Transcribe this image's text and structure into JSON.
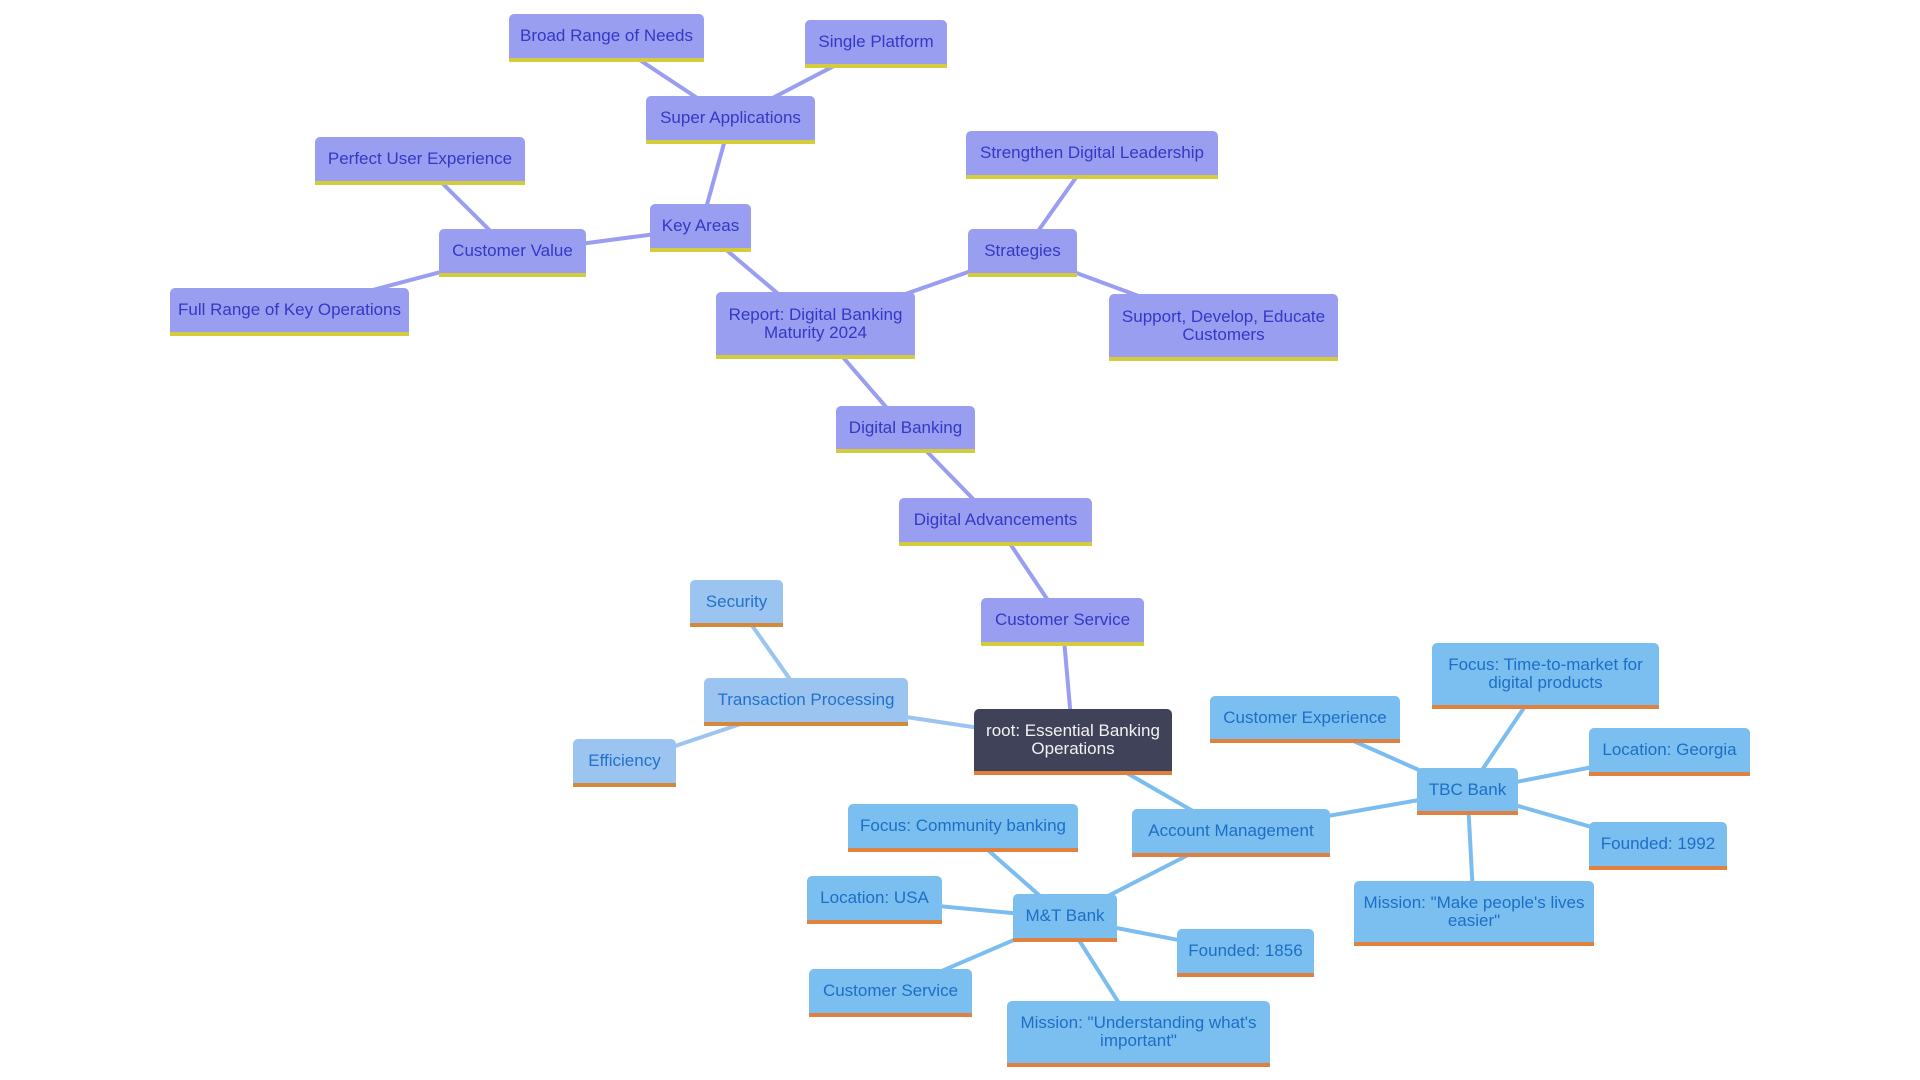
{
  "diagram": {
    "type": "mindmap",
    "colors": {
      "root_fill": "#404259",
      "root_text": "#f2f2f2",
      "purple_fill": "#999ef1",
      "purple_text": "#3438c5",
      "purple_accent": "#d4cb3d",
      "blue_fill": "#7bbef0",
      "blue_text": "#1d6fc6",
      "blue_accent": "#e0813f",
      "lightblue_fill": "#9cc4f0",
      "lightblue_text": "#2272cc",
      "purple_edge": "#999ef1",
      "blue_edge": "#7cbdef",
      "lightblue_edge": "#9cc4f0"
    },
    "nodes": [
      {
        "id": "root",
        "label": "root: Essential Banking\nOperations",
        "style": "root"
      },
      {
        "id": "customer_service_p",
        "label": "Customer Service",
        "style": "purple",
        "parent": "root"
      },
      {
        "id": "digital_advancements",
        "label": "Digital Advancements",
        "style": "purple",
        "parent": "customer_service_p"
      },
      {
        "id": "digital_banking",
        "label": "Digital Banking",
        "style": "purple",
        "parent": "digital_advancements"
      },
      {
        "id": "report",
        "label": "Report: Digital Banking\nMaturity 2024",
        "style": "purple",
        "parent": "digital_banking"
      },
      {
        "id": "key_areas",
        "label": "Key Areas",
        "style": "purple",
        "parent": "report"
      },
      {
        "id": "super_apps",
        "label": "Super Applications",
        "style": "purple",
        "parent": "key_areas"
      },
      {
        "id": "broad_range",
        "label": "Broad Range of Needs",
        "style": "purple",
        "parent": "super_apps"
      },
      {
        "id": "single_platform",
        "label": "Single Platform",
        "style": "purple",
        "parent": "super_apps"
      },
      {
        "id": "customer_value",
        "label": "Customer Value",
        "style": "purple",
        "parent": "key_areas"
      },
      {
        "id": "perfect_ux",
        "label": "Perfect User Experience",
        "style": "purple",
        "parent": "customer_value"
      },
      {
        "id": "full_range",
        "label": "Full Range of Key Operations",
        "style": "purple",
        "parent": "customer_value"
      },
      {
        "id": "strategies",
        "label": "Strategies",
        "style": "purple",
        "parent": "report"
      },
      {
        "id": "strengthen",
        "label": "Strengthen Digital Leadership",
        "style": "purple",
        "parent": "strategies"
      },
      {
        "id": "support",
        "label": "Support, Develop, Educate\nCustomers",
        "style": "purple",
        "parent": "strategies"
      },
      {
        "id": "transaction",
        "label": "Transaction Processing",
        "style": "lightblue",
        "parent": "root"
      },
      {
        "id": "security",
        "label": "Security",
        "style": "lightblue",
        "parent": "transaction"
      },
      {
        "id": "efficiency",
        "label": "Efficiency",
        "style": "lightblue",
        "parent": "transaction"
      },
      {
        "id": "account_mgmt",
        "label": "Account Management",
        "style": "blue",
        "parent": "root"
      },
      {
        "id": "tbc_bank",
        "label": "TBC Bank",
        "style": "blue",
        "parent": "account_mgmt"
      },
      {
        "id": "tbc_cx",
        "label": "Customer Experience",
        "style": "blue",
        "parent": "tbc_bank"
      },
      {
        "id": "tbc_focus",
        "label": "Focus: Time-to-market for\ndigital products",
        "style": "blue",
        "parent": "tbc_bank"
      },
      {
        "id": "tbc_location",
        "label": "Location: Georgia",
        "style": "blue",
        "parent": "tbc_bank"
      },
      {
        "id": "tbc_founded",
        "label": "Founded: 1992",
        "style": "blue",
        "parent": "tbc_bank"
      },
      {
        "id": "tbc_mission",
        "label": "Mission: \"Make people's lives\neasier\"",
        "style": "blue",
        "parent": "tbc_bank"
      },
      {
        "id": "mt_bank",
        "label": "M&T Bank",
        "style": "blue",
        "parent": "account_mgmt"
      },
      {
        "id": "mt_focus",
        "label": "Focus: Community banking",
        "style": "blue",
        "parent": "mt_bank"
      },
      {
        "id": "mt_location",
        "label": "Location: USA",
        "style": "blue",
        "parent": "mt_bank"
      },
      {
        "id": "mt_cs",
        "label": "Customer Service",
        "style": "blue",
        "parent": "mt_bank"
      },
      {
        "id": "mt_founded",
        "label": "Founded: 1856",
        "style": "blue",
        "parent": "mt_bank"
      },
      {
        "id": "mt_mission",
        "label": "Mission: \"Understanding what's\nimportant\"",
        "style": "blue",
        "parent": "mt_bank"
      }
    ]
  }
}
